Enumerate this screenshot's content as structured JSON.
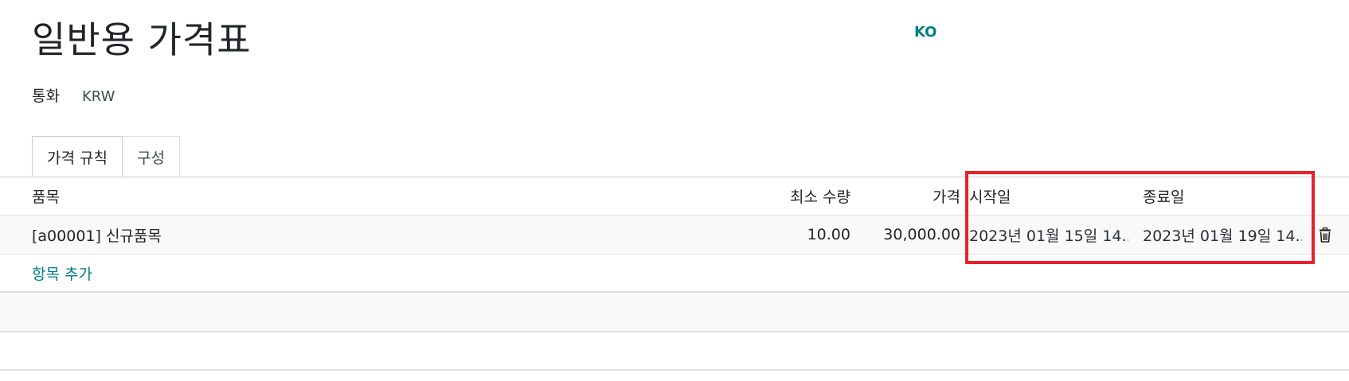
{
  "header": {
    "title": "일반용 가격표",
    "language_badge": "KO"
  },
  "currency": {
    "label": "통화",
    "value": "KRW"
  },
  "tabs": [
    {
      "label": "가격 규칙",
      "active": true
    },
    {
      "label": "구성",
      "active": false
    }
  ],
  "table": {
    "columns": {
      "product": "품목",
      "min_qty": "최소 수량",
      "price": "가격",
      "start_date": "시작일",
      "end_date": "종료일"
    },
    "rows": [
      {
        "product": "[a00001] 신규품목",
        "min_qty": "10.00",
        "price": "30,000.00",
        "start_date": "2023년 01월 15일 14...",
        "end_date": "2023년 01월 19일 14...",
        "action_icon": "trash-icon"
      }
    ],
    "add_line_label": "항목 추가"
  },
  "colors": {
    "accent": "#017e84",
    "highlight": "#e8212b",
    "text": "#212529"
  }
}
